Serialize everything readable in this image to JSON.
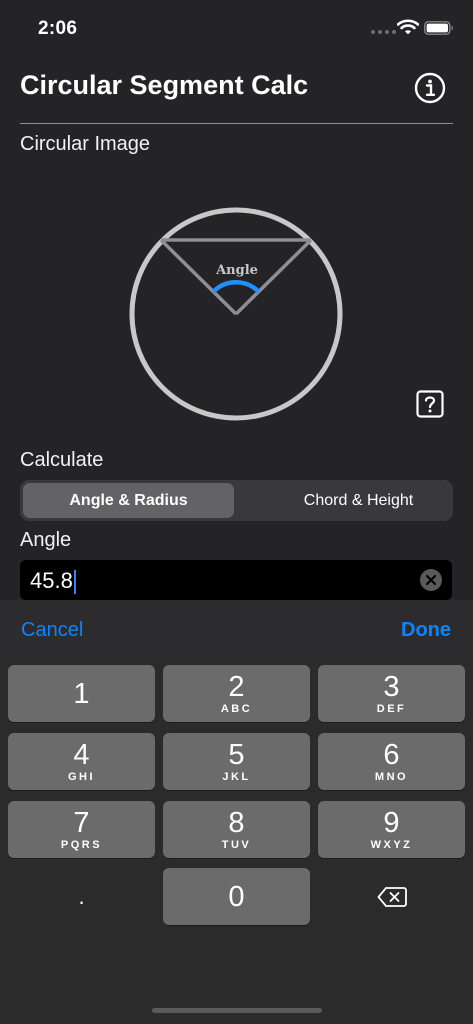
{
  "status_bar": {
    "time": "2:06",
    "wifi_icon": "wifi-icon",
    "battery_icon": "battery-icon"
  },
  "nav": {
    "title": "Circular Segment Calc",
    "info_icon": "info-icon"
  },
  "image_section": {
    "label": "Circular Image",
    "diagram_angle_label": "Angle",
    "help_icon": "question-mark-icon",
    "colors": {
      "circle": "#c8c8c8",
      "chord": "#8e8e93",
      "arc": "#1e90ff"
    }
  },
  "calculate": {
    "label": "Calculate",
    "options": [
      "Angle & Radius",
      "Chord & Height"
    ],
    "selected": "Angle & Radius"
  },
  "angle": {
    "label": "Angle",
    "value": "45.8",
    "clear_icon": "clear-icon"
  },
  "toolbar": {
    "cancel": "Cancel",
    "done": "Done"
  },
  "keypad": {
    "keys": [
      {
        "digit": "1",
        "letters": ""
      },
      {
        "digit": "2",
        "letters": "ABC"
      },
      {
        "digit": "3",
        "letters": "DEF"
      },
      {
        "digit": "4",
        "letters": "GHI"
      },
      {
        "digit": "5",
        "letters": "JKL"
      },
      {
        "digit": "6",
        "letters": "MNO"
      },
      {
        "digit": "7",
        "letters": "PQRS"
      },
      {
        "digit": "8",
        "letters": "TUV"
      },
      {
        "digit": "9",
        "letters": "WXYZ"
      },
      {
        "digit": "0",
        "letters": ""
      }
    ],
    "decimal": ".",
    "delete_icon": "backspace-icon"
  }
}
